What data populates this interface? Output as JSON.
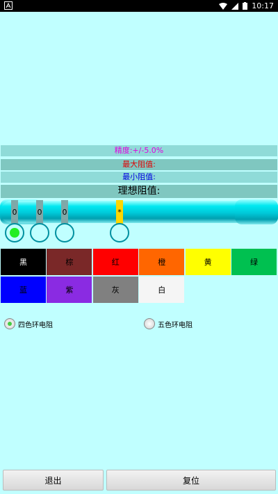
{
  "status_bar": {
    "time": "10:17",
    "left_icon": "notification-a-icon",
    "right_icons": [
      "wifi-icon",
      "signal-icon",
      "battery-icon"
    ]
  },
  "info": {
    "precision": "精度:+/-5.0%",
    "max_value": "最大阻值:",
    "min_value": "最小阻值:",
    "ideal_value": "理想阻值:"
  },
  "bands": [
    "0",
    "0",
    "0",
    "*"
  ],
  "band_selected_index": 3,
  "radio_selected_index": 0,
  "colors": [
    {
      "label": "黑",
      "color": "#000000",
      "text_color": "#ffffff"
    },
    {
      "label": "棕",
      "color": "#7a2828",
      "text_color": "#000000"
    },
    {
      "label": "红",
      "color": "#ff0000",
      "text_color": "#000000"
    },
    {
      "label": "橙",
      "color": "#ff6600",
      "text_color": "#000000"
    },
    {
      "label": "黄",
      "color": "#ffff00",
      "text_color": "#000000"
    },
    {
      "label": "绿",
      "color": "#00c050",
      "text_color": "#000000"
    },
    {
      "label": "蓝",
      "color": "#0000ff",
      "text_color": "#000000"
    },
    {
      "label": "紫",
      "color": "#8a2be2",
      "text_color": "#000000"
    },
    {
      "label": "灰",
      "color": "#808080",
      "text_color": "#000000"
    },
    {
      "label": "白",
      "color": "#f5f5f5",
      "text_color": "#000000"
    }
  ],
  "modes": [
    {
      "label": "四色环电阻",
      "selected": true
    },
    {
      "label": "五色环电阻",
      "selected": false
    }
  ],
  "buttons": {
    "exit": "退出",
    "reset": "复位"
  }
}
